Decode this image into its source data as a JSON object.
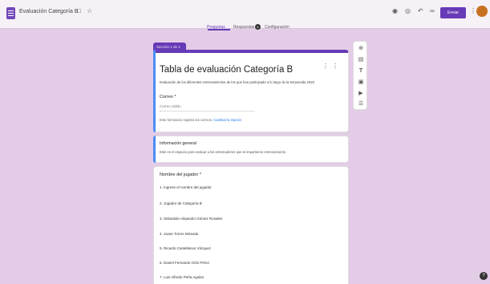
{
  "header": {
    "doc_title": "Evaluación Categoría B",
    "icons": [
      "forms-doc-icon",
      "folder-icon",
      "star-icon",
      "palette-icon",
      "eye-icon",
      "undo-icon",
      "link-icon",
      "more-icon"
    ],
    "send_label": "Enviar",
    "avatar_color": "#c6711f"
  },
  "tabs": {
    "questions": "Preguntas",
    "responses": "Respuestas",
    "responses_badge": "6",
    "settings": "Configuración"
  },
  "section": {
    "label": "Sección 1 de 2"
  },
  "form": {
    "title": "Tabla de evaluación Categoría B",
    "description": "Evaluación de los diferentes entrenamientos de los que han participado a lo largo de la temporada 2023",
    "email_label": "Correo *",
    "email_placeholder": "Correo válido",
    "email_note": "Este formulario registra los correos.",
    "email_note_link": "Cambiar la Opción"
  },
  "info": {
    "title": "Información general",
    "text": "Este es el espacio para evaluar a los entrenadores que te impartieron entrenamiento"
  },
  "question": {
    "title": "Nombre del jugador *",
    "options": [
      "1. Ingrese el nombre del jugador",
      "2. Jugador de Categoría B",
      "3. Sebastián Alejandro Gómez Rosales",
      "4. Javier Torres Miranda",
      "5. Ricardo Castellanos Vázquez",
      "6. Daniel Fernando Ortiz Pérez",
      "7. Luis Alfredo Peña Aguilar"
    ]
  },
  "side_toolbar": [
    "add-question-icon",
    "import-icon",
    "title-icon",
    "image-icon",
    "video-icon",
    "section-icon"
  ],
  "colors": {
    "accent": "#673ab7",
    "background": "#e3cde6",
    "focus": "#4b8df8"
  }
}
